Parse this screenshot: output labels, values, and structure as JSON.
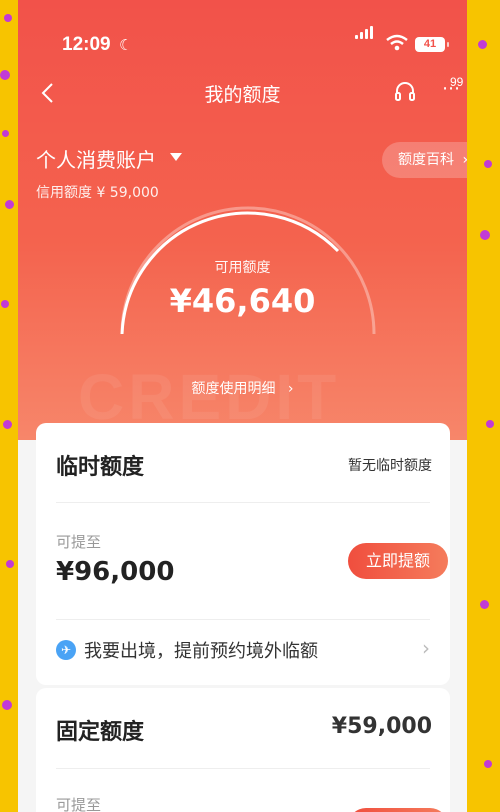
{
  "status_bar": {
    "time": "12:09",
    "battery": "41"
  },
  "header": {
    "title": "我的额度",
    "notification_count": "99"
  },
  "account": {
    "name": "个人消费账户",
    "credit_limit": "信用额度 ¥ 59,000",
    "wiki_button": "额度百科"
  },
  "available": {
    "label": "可用额度",
    "amount": "¥46,640",
    "detail_link": "额度使用明细"
  },
  "temp_quota": {
    "title": "临时额度",
    "status": "暂无临时额度",
    "raise_label": "可提至",
    "raise_amount": "¥96,000",
    "raise_button": "立即提额",
    "travel_text": "我要出境，提前预约境外临额"
  },
  "fixed_quota": {
    "title": "固定额度",
    "amount": "¥59,000",
    "raise_label": "可提至"
  },
  "colors": {
    "primary": "#f2524a",
    "background": "#f7c400"
  }
}
